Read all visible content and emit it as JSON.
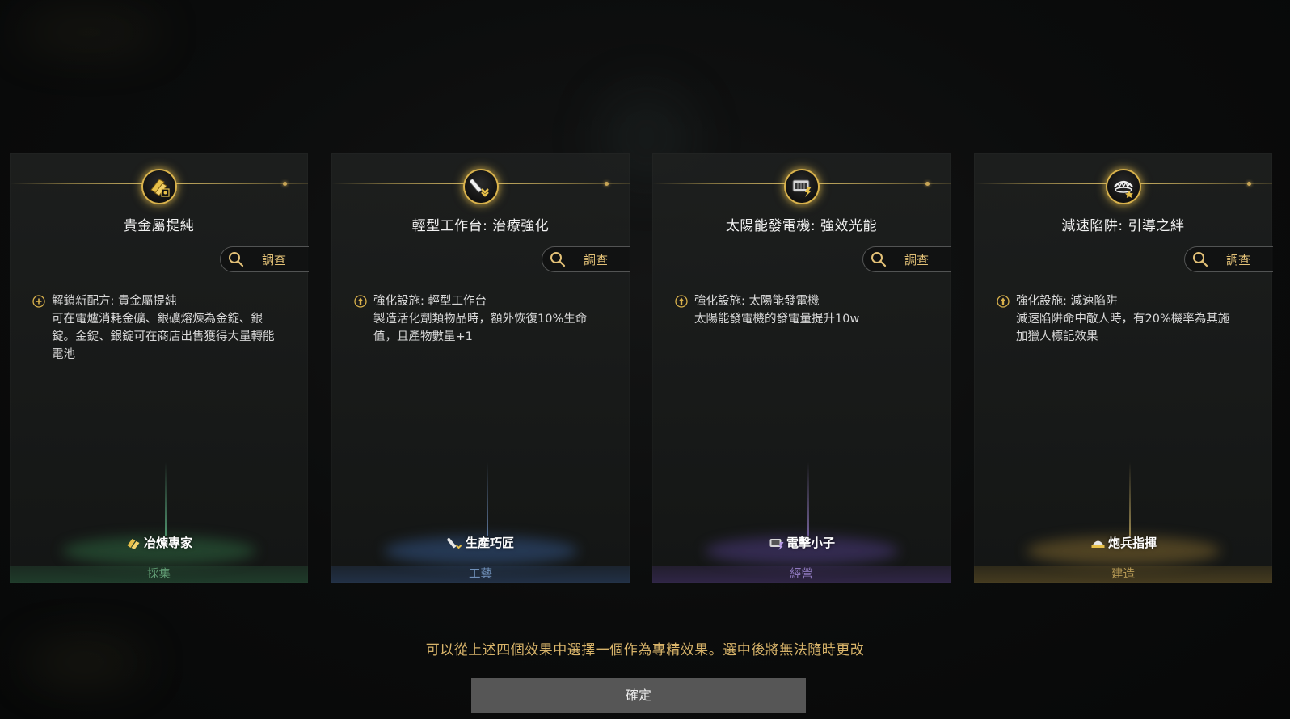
{
  "cards": [
    {
      "title": "貴金屬提純",
      "investigate_label": "調查",
      "effect_icon": "plus-circle-icon",
      "effect_header": "解鎖新配方: 貴金屬提純",
      "effect_body": "可在電爐消耗金礦、銀礦熔煉為金錠、銀\n錠。金錠、銀錠可在商店出售獲得大量轉能\n電池",
      "badge_icon": "gold-bars-icon",
      "badge_label": "冶煉專家",
      "category": "採集",
      "accent": "#3c8a5a"
    },
    {
      "title": "輕型工作台: 治療強化",
      "investigate_label": "調查",
      "effect_icon": "upgrade-arrow-icon",
      "effect_header": "強化設施: 輕型工作台",
      "effect_body": "製造活化劑類物品時，額外恢復10%生命\n值，且產物數量+1",
      "badge_icon": "wrench-icon",
      "badge_label": "生產巧匠",
      "category": "工藝",
      "accent": "#3f6fa8"
    },
    {
      "title": "太陽能發電機: 強效光能",
      "investigate_label": "調查",
      "effect_icon": "upgrade-arrow-icon",
      "effect_header": "強化設施: 太陽能發電機",
      "effect_body": "太陽能發電機的發電量提升10w",
      "badge_icon": "generator-icon",
      "badge_label": "電擊小子",
      "category": "經營",
      "accent": "#6a4fa6"
    },
    {
      "title": "減速陷阱: 引導之絆",
      "investigate_label": "調查",
      "effect_icon": "upgrade-arrow-icon",
      "effect_header": "強化設施: 減速陷阱",
      "effect_body": "減速陷阱命中敵人時，有20%機率為其施\n加獵人標記效果",
      "badge_icon": "helmet-icon",
      "badge_label": "炮兵指揮",
      "category": "建造",
      "accent": "#a88a3a"
    }
  ],
  "hint": "可以從上述四個效果中選擇一個作為專精效果。選中後將無法隨時更改",
  "confirm_label": "確定"
}
